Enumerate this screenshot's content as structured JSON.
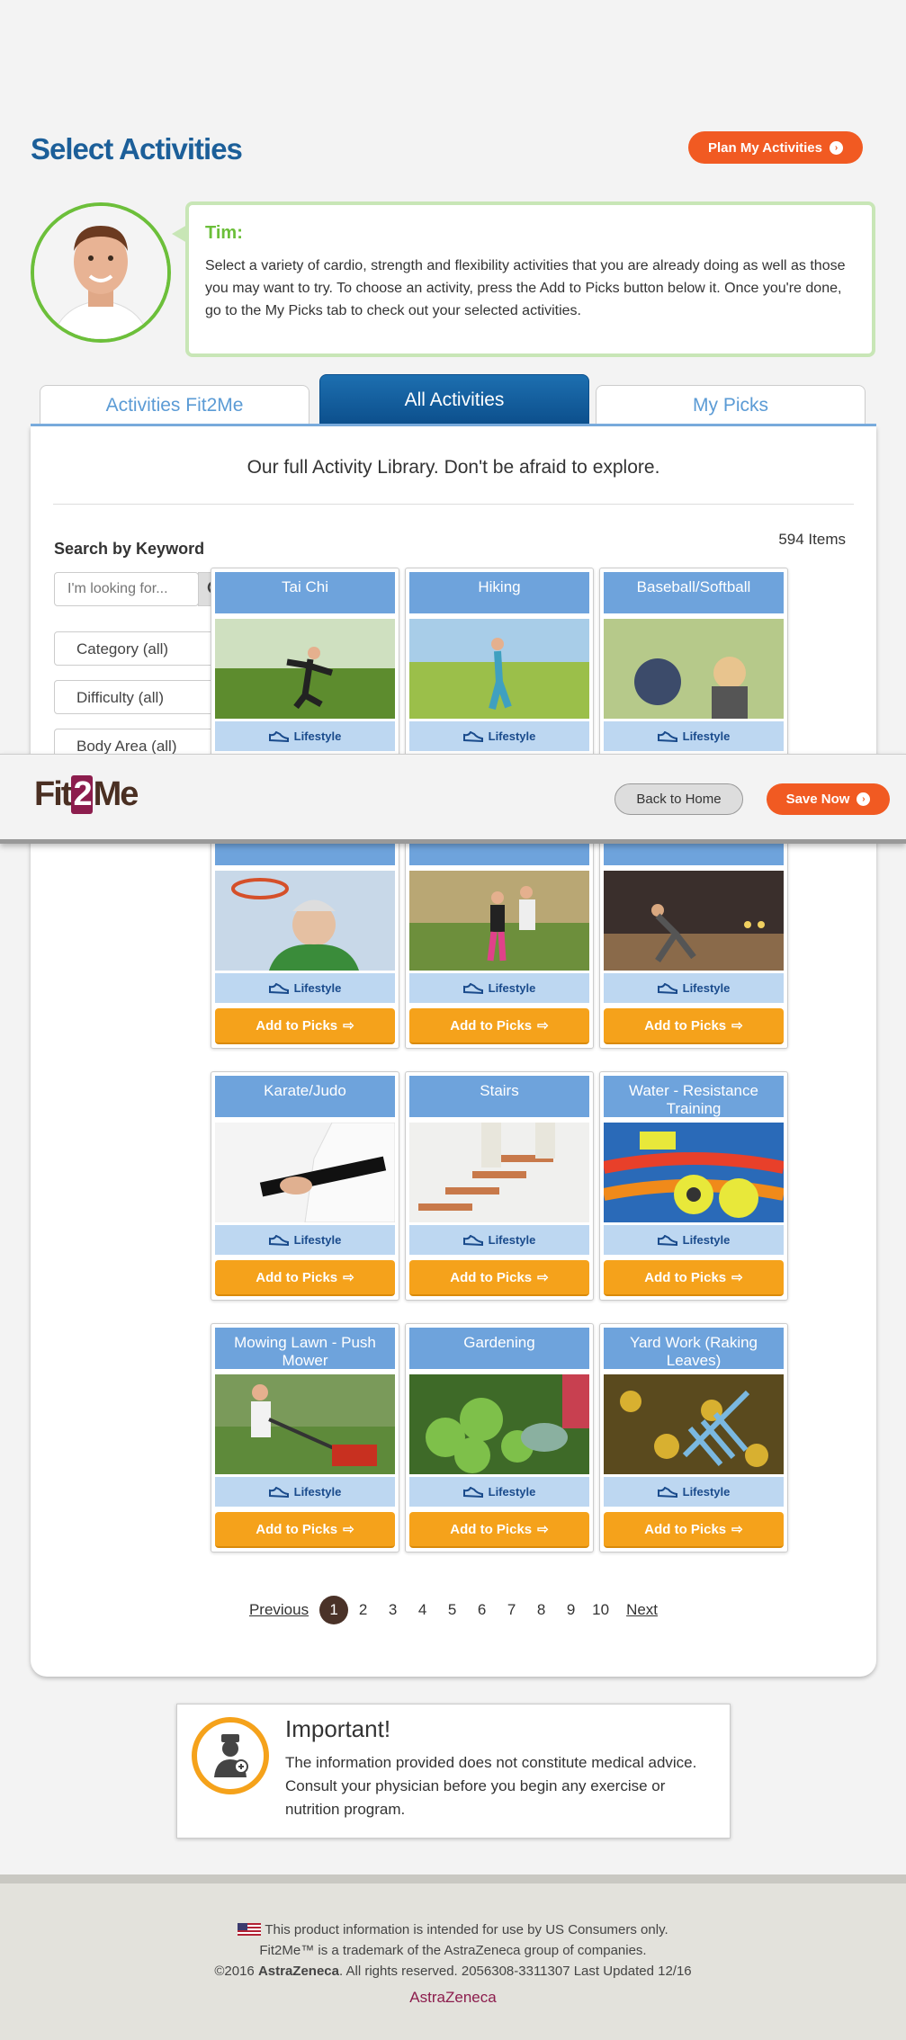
{
  "header": {
    "title": "Select Activities",
    "plan_button": "Plan My Activities"
  },
  "coach": {
    "name": "Tim:",
    "message": "Select a variety of cardio, strength and flexibility activities that you are already doing as well as those you may want to try. To choose an activity, press the Add to Picks button below it. Once you're done, go to the My Picks tab to check out your selected activities."
  },
  "tabs": [
    "Activities Fit2Me",
    "All Activities",
    "My Picks"
  ],
  "library": {
    "heading": "Our full Activity Library. Don't be afraid to explore.",
    "search_label": "Search by Keyword",
    "search_placeholder": "I'm looking for...",
    "item_count": "594 Items",
    "filters": [
      "Category (all)",
      "Difficulty (all)",
      "Body Area (all)"
    ]
  },
  "cards": [
    {
      "title": "Tai Chi",
      "tag": "Lifestyle",
      "button": "Add to Picks"
    },
    {
      "title": "Hiking",
      "tag": "Lifestyle",
      "button": "Add to Picks"
    },
    {
      "title": "Baseball/Softball",
      "tag": "Lifestyle",
      "button": "Add to Picks"
    },
    {
      "title": "",
      "tag": "Lifestyle",
      "button": "Add to Picks"
    },
    {
      "title": "",
      "tag": "Lifestyle",
      "button": "Add to Picks"
    },
    {
      "title": "",
      "tag": "Lifestyle",
      "button": "Add to Picks"
    },
    {
      "title": "Karate/Judo",
      "tag": "Lifestyle",
      "button": "Add to Picks"
    },
    {
      "title": "Stairs",
      "tag": "Lifestyle",
      "button": "Add to Picks"
    },
    {
      "title": "Water - Resistance Training",
      "tag": "Lifestyle",
      "button": "Add to Picks"
    },
    {
      "title": "Mowing Lawn - Push Mower",
      "tag": "Lifestyle",
      "button": "Add to Picks"
    },
    {
      "title": "Gardening",
      "tag": "Lifestyle",
      "button": "Add to Picks"
    },
    {
      "title": "Yard Work (Raking Leaves)",
      "tag": "Lifestyle",
      "button": "Add to Picks"
    }
  ],
  "pagination": {
    "previous": "Previous",
    "pages": [
      "1",
      "2",
      "3",
      "4",
      "5",
      "6",
      "7",
      "8",
      "9",
      "10"
    ],
    "current": "1",
    "next": "Next"
  },
  "sticky_bar": {
    "logo": {
      "pre": "Fit",
      "num": "2",
      "post": "Me"
    },
    "back": "Back to Home",
    "save": "Save Now"
  },
  "important": {
    "title": "Important!",
    "text": "The information provided does not constitute medical advice. Consult your physician before you begin any exercise or nutrition program."
  },
  "footer": {
    "line1": "This product information is intended for use by US Consumers only.",
    "line2": "Fit2Me™ is a trademark of the AstraZeneca group of companies.",
    "line3_pre": "©2016 ",
    "line3_brand": "AstraZeneca",
    "line3_post": ". All rights reserved. 2056308-3311307 Last Updated 12/16",
    "brand_logo": "AstraZeneca"
  },
  "colors": {
    "brand_blue": "#1c5f99",
    "orange": "#f15a22",
    "gold": "#f5a21b",
    "green": "#6cbf3a",
    "card_head": "#6ea3dc"
  }
}
